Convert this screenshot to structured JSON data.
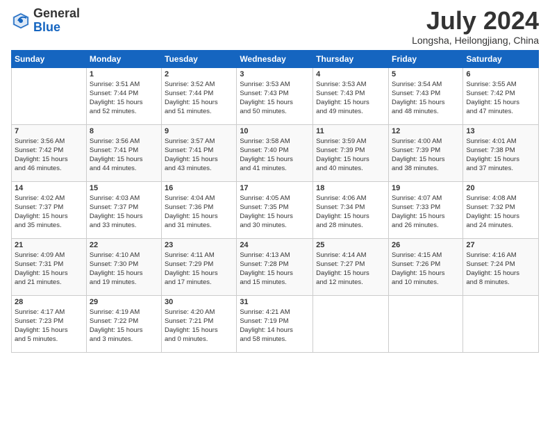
{
  "header": {
    "logo_general": "General",
    "logo_blue": "Blue",
    "month_title": "July 2024",
    "location": "Longsha, Heilongjiang, China"
  },
  "days_of_week": [
    "Sunday",
    "Monday",
    "Tuesday",
    "Wednesday",
    "Thursday",
    "Friday",
    "Saturday"
  ],
  "weeks": [
    [
      {
        "day": "",
        "lines": []
      },
      {
        "day": "1",
        "lines": [
          "Sunrise: 3:51 AM",
          "Sunset: 7:44 PM",
          "Daylight: 15 hours",
          "and 52 minutes."
        ]
      },
      {
        "day": "2",
        "lines": [
          "Sunrise: 3:52 AM",
          "Sunset: 7:44 PM",
          "Daylight: 15 hours",
          "and 51 minutes."
        ]
      },
      {
        "day": "3",
        "lines": [
          "Sunrise: 3:53 AM",
          "Sunset: 7:43 PM",
          "Daylight: 15 hours",
          "and 50 minutes."
        ]
      },
      {
        "day": "4",
        "lines": [
          "Sunrise: 3:53 AM",
          "Sunset: 7:43 PM",
          "Daylight: 15 hours",
          "and 49 minutes."
        ]
      },
      {
        "day": "5",
        "lines": [
          "Sunrise: 3:54 AM",
          "Sunset: 7:43 PM",
          "Daylight: 15 hours",
          "and 48 minutes."
        ]
      },
      {
        "day": "6",
        "lines": [
          "Sunrise: 3:55 AM",
          "Sunset: 7:42 PM",
          "Daylight: 15 hours",
          "and 47 minutes."
        ]
      }
    ],
    [
      {
        "day": "7",
        "lines": [
          "Sunrise: 3:56 AM",
          "Sunset: 7:42 PM",
          "Daylight: 15 hours",
          "and 46 minutes."
        ]
      },
      {
        "day": "8",
        "lines": [
          "Sunrise: 3:56 AM",
          "Sunset: 7:41 PM",
          "Daylight: 15 hours",
          "and 44 minutes."
        ]
      },
      {
        "day": "9",
        "lines": [
          "Sunrise: 3:57 AM",
          "Sunset: 7:41 PM",
          "Daylight: 15 hours",
          "and 43 minutes."
        ]
      },
      {
        "day": "10",
        "lines": [
          "Sunrise: 3:58 AM",
          "Sunset: 7:40 PM",
          "Daylight: 15 hours",
          "and 41 minutes."
        ]
      },
      {
        "day": "11",
        "lines": [
          "Sunrise: 3:59 AM",
          "Sunset: 7:39 PM",
          "Daylight: 15 hours",
          "and 40 minutes."
        ]
      },
      {
        "day": "12",
        "lines": [
          "Sunrise: 4:00 AM",
          "Sunset: 7:39 PM",
          "Daylight: 15 hours",
          "and 38 minutes."
        ]
      },
      {
        "day": "13",
        "lines": [
          "Sunrise: 4:01 AM",
          "Sunset: 7:38 PM",
          "Daylight: 15 hours",
          "and 37 minutes."
        ]
      }
    ],
    [
      {
        "day": "14",
        "lines": [
          "Sunrise: 4:02 AM",
          "Sunset: 7:37 PM",
          "Daylight: 15 hours",
          "and 35 minutes."
        ]
      },
      {
        "day": "15",
        "lines": [
          "Sunrise: 4:03 AM",
          "Sunset: 7:37 PM",
          "Daylight: 15 hours",
          "and 33 minutes."
        ]
      },
      {
        "day": "16",
        "lines": [
          "Sunrise: 4:04 AM",
          "Sunset: 7:36 PM",
          "Daylight: 15 hours",
          "and 31 minutes."
        ]
      },
      {
        "day": "17",
        "lines": [
          "Sunrise: 4:05 AM",
          "Sunset: 7:35 PM",
          "Daylight: 15 hours",
          "and 30 minutes."
        ]
      },
      {
        "day": "18",
        "lines": [
          "Sunrise: 4:06 AM",
          "Sunset: 7:34 PM",
          "Daylight: 15 hours",
          "and 28 minutes."
        ]
      },
      {
        "day": "19",
        "lines": [
          "Sunrise: 4:07 AM",
          "Sunset: 7:33 PM",
          "Daylight: 15 hours",
          "and 26 minutes."
        ]
      },
      {
        "day": "20",
        "lines": [
          "Sunrise: 4:08 AM",
          "Sunset: 7:32 PM",
          "Daylight: 15 hours",
          "and 24 minutes."
        ]
      }
    ],
    [
      {
        "day": "21",
        "lines": [
          "Sunrise: 4:09 AM",
          "Sunset: 7:31 PM",
          "Daylight: 15 hours",
          "and 21 minutes."
        ]
      },
      {
        "day": "22",
        "lines": [
          "Sunrise: 4:10 AM",
          "Sunset: 7:30 PM",
          "Daylight: 15 hours",
          "and 19 minutes."
        ]
      },
      {
        "day": "23",
        "lines": [
          "Sunrise: 4:11 AM",
          "Sunset: 7:29 PM",
          "Daylight: 15 hours",
          "and 17 minutes."
        ]
      },
      {
        "day": "24",
        "lines": [
          "Sunrise: 4:13 AM",
          "Sunset: 7:28 PM",
          "Daylight: 15 hours",
          "and 15 minutes."
        ]
      },
      {
        "day": "25",
        "lines": [
          "Sunrise: 4:14 AM",
          "Sunset: 7:27 PM",
          "Daylight: 15 hours",
          "and 12 minutes."
        ]
      },
      {
        "day": "26",
        "lines": [
          "Sunrise: 4:15 AM",
          "Sunset: 7:26 PM",
          "Daylight: 15 hours",
          "and 10 minutes."
        ]
      },
      {
        "day": "27",
        "lines": [
          "Sunrise: 4:16 AM",
          "Sunset: 7:24 PM",
          "Daylight: 15 hours",
          "and 8 minutes."
        ]
      }
    ],
    [
      {
        "day": "28",
        "lines": [
          "Sunrise: 4:17 AM",
          "Sunset: 7:23 PM",
          "Daylight: 15 hours",
          "and 5 minutes."
        ]
      },
      {
        "day": "29",
        "lines": [
          "Sunrise: 4:19 AM",
          "Sunset: 7:22 PM",
          "Daylight: 15 hours",
          "and 3 minutes."
        ]
      },
      {
        "day": "30",
        "lines": [
          "Sunrise: 4:20 AM",
          "Sunset: 7:21 PM",
          "Daylight: 15 hours",
          "and 0 minutes."
        ]
      },
      {
        "day": "31",
        "lines": [
          "Sunrise: 4:21 AM",
          "Sunset: 7:19 PM",
          "Daylight: 14 hours",
          "and 58 minutes."
        ]
      },
      {
        "day": "",
        "lines": []
      },
      {
        "day": "",
        "lines": []
      },
      {
        "day": "",
        "lines": []
      }
    ]
  ]
}
